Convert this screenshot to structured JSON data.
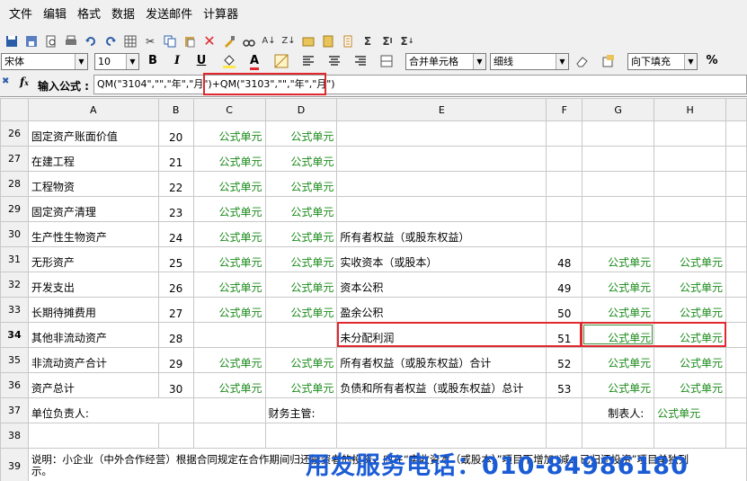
{
  "menu": [
    "文件",
    "编辑",
    "格式",
    "数据",
    "发送邮件",
    "计算器"
  ],
  "toolbar2": {
    "font": "宋体",
    "size": "10",
    "bold": "B",
    "italic": "I",
    "underline": "U",
    "font_color_glyph": "A",
    "merge": "合并单元格",
    "border": "细线",
    "fill": "向下填充",
    "percent": "%"
  },
  "formula": {
    "label": "输入公式 :",
    "value": "QM(\"3104\",\"\",\"年\",\"月\")+QM(\"3103\",\"\",\"年\",\"月\")"
  },
  "columns": [
    "A",
    "B",
    "C",
    "D",
    "E",
    "F",
    "G",
    "H"
  ],
  "rows": [
    {
      "n": "26",
      "a": "固定资产账面价值",
      "b": "20",
      "c": "公式单元",
      "d": "公式单元",
      "e": "",
      "f": "",
      "g": "",
      "h": ""
    },
    {
      "n": "27",
      "a": "在建工程",
      "b": "21",
      "c": "公式单元",
      "d": "公式单元",
      "e": "",
      "f": "",
      "g": "",
      "h": ""
    },
    {
      "n": "28",
      "a": "工程物资",
      "b": "22",
      "c": "公式单元",
      "d": "公式单元",
      "e": "",
      "f": "",
      "g": "",
      "h": ""
    },
    {
      "n": "29",
      "a": "固定资产清理",
      "b": "23",
      "c": "公式单元",
      "d": "公式单元",
      "e": "",
      "f": "",
      "g": "",
      "h": ""
    },
    {
      "n": "30",
      "a": "生产性生物资产",
      "b": "24",
      "c": "公式单元",
      "d": "公式单元",
      "e": "所有者权益（或股东权益）",
      "f": "",
      "g": "",
      "h": ""
    },
    {
      "n": "31",
      "a": "无形资产",
      "b": "25",
      "c": "公式单元",
      "d": "公式单元",
      "e": "实收资本（或股本）",
      "f": "48",
      "g": "公式单元",
      "h": "公式单元"
    },
    {
      "n": "32",
      "a": "开发支出",
      "b": "26",
      "c": "公式单元",
      "d": "公式单元",
      "e": "资本公积",
      "f": "49",
      "g": "公式单元",
      "h": "公式单元"
    },
    {
      "n": "33",
      "a": "长期待摊费用",
      "b": "27",
      "c": "公式单元",
      "d": "公式单元",
      "e": "盈余公积",
      "f": "50",
      "g": "公式单元",
      "h": "公式单元"
    },
    {
      "n": "34",
      "a": "其他非流动资产",
      "b": "28",
      "c": "",
      "d": "",
      "e": "未分配利润",
      "f": "51",
      "g": "公式单元",
      "h": "公式单元"
    },
    {
      "n": "35",
      "a": "非流动资产合计",
      "b": "29",
      "c": "公式单元",
      "d": "公式单元",
      "e": "所有者权益（或股东权益）合计",
      "f": "52",
      "g": "公式单元",
      "h": "公式单元"
    },
    {
      "n": "36",
      "a": "资产总计",
      "b": "30",
      "c": "公式单元",
      "d": "公式单元",
      "e": "负债和所有者权益（或股东权益）总计",
      "f": "53",
      "g": "公式单元",
      "h": "公式单元"
    }
  ],
  "row37": {
    "n": "37",
    "a": "单位负责人:",
    "d": "财务主管:",
    "g": "制表人:",
    "h": "公式单元"
  },
  "row38": {
    "n": "38"
  },
  "row39": {
    "n": "39",
    "text": "说明：小企业（中外合作经营）根据合同规定在合作期间归还投资者的投资，应在“实收资本（或股本）”项目下增加“减：已归还投资”项目单独列示。"
  },
  "watermark": "用友服务电话：010-84986180",
  "colors": {
    "formula_green": "#1a8a1a",
    "highlight_red": "#e0282e",
    "watermark_blue": "#1a5cd6"
  }
}
